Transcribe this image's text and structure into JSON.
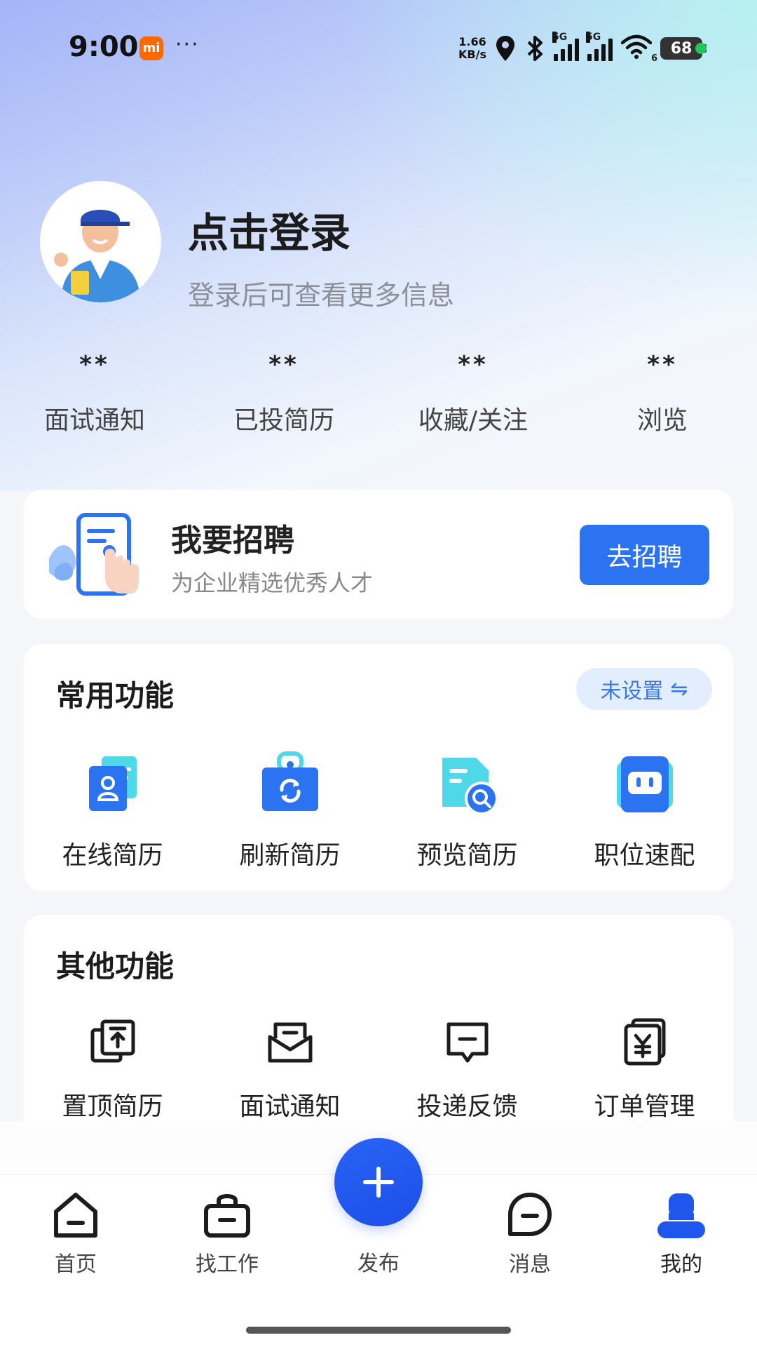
{
  "status_bar": {
    "time": "9:00",
    "mi_badge": "mi",
    "dots": "···",
    "net_speed_value": "1.66",
    "net_speed_unit": "KB/s",
    "signal_label_1": "5G",
    "signal_label_2": "5G",
    "wifi_sub": "6",
    "battery": "68"
  },
  "profile": {
    "login_title": "点击登录",
    "login_subtitle": "登录后可查看更多信息"
  },
  "stats": [
    {
      "value": "**",
      "label": "面试通知"
    },
    {
      "value": "**",
      "label": "已投简历"
    },
    {
      "value": "**",
      "label": "收藏/关注"
    },
    {
      "value": "**",
      "label": "浏览"
    }
  ],
  "recruit": {
    "title": "我要招聘",
    "subtitle": "为企业精选优秀人才",
    "button": "去招聘"
  },
  "common_functions": {
    "title": "常用功能",
    "setting_label": "未设置",
    "setting_glyph": "⇋",
    "items": [
      {
        "label": "在线简历",
        "icon": "online-resume-icon"
      },
      {
        "label": "刷新简历",
        "icon": "refresh-resume-icon"
      },
      {
        "label": "预览简历",
        "icon": "preview-resume-icon"
      },
      {
        "label": "职位速配",
        "icon": "job-match-icon"
      }
    ]
  },
  "other_functions": {
    "title": "其他功能",
    "items": [
      {
        "label": "置顶简历",
        "icon": "pin-resume-icon"
      },
      {
        "label": "面试通知",
        "icon": "interview-mail-icon"
      },
      {
        "label": "投递反馈",
        "icon": "feedback-icon"
      },
      {
        "label": "订单管理",
        "icon": "order-yen-icon"
      }
    ]
  },
  "bottom_nav": {
    "items": [
      {
        "label": "首页",
        "icon": "home-icon"
      },
      {
        "label": "找工作",
        "icon": "briefcase-icon"
      },
      {
        "label": "发布",
        "icon": "plus-icon"
      },
      {
        "label": "消息",
        "icon": "message-icon"
      },
      {
        "label": "我的",
        "icon": "profile-icon"
      }
    ],
    "active": "我的"
  },
  "colors": {
    "accent": "#2b73f0",
    "fab": "#1f56ee",
    "setting_pill_bg": "#e2edfd"
  }
}
